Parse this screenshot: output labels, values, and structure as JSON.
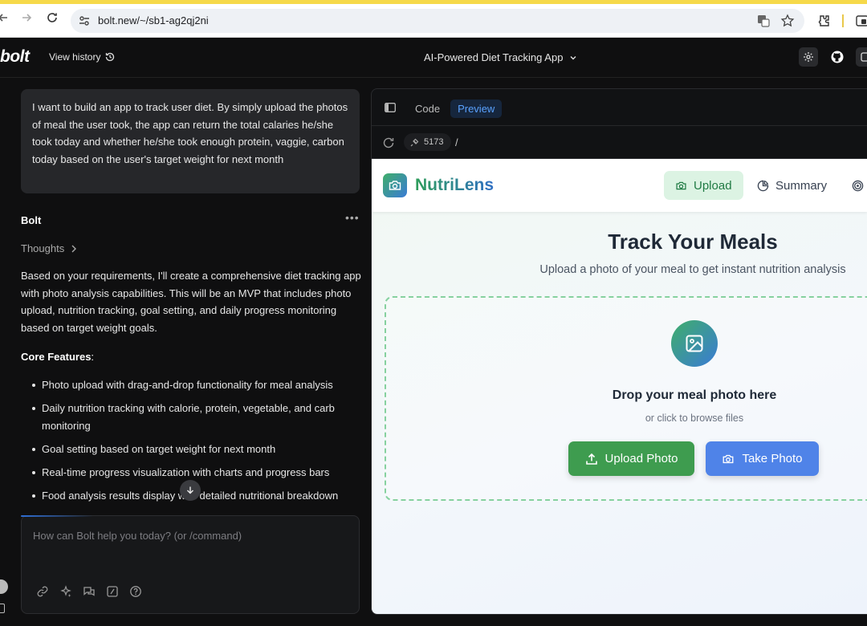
{
  "browser": {
    "url": "bolt.new/~/sb1-ag2qj2ni"
  },
  "header": {
    "logo": "bolt",
    "view_history": "View history",
    "project_title": "AI-Powered Diet Tracking App"
  },
  "chat": {
    "user_message": "I want to build an app to track user diet. By simply upload the photos of meal the user took, the app can return the total calaries he/she took today and whether he/she took enough protein, vaggie, carbon today based on the user's target weight for next month",
    "assistant_name": "Bolt",
    "thoughts_label": "Thoughts",
    "response_paragraph": "Based on your requirements, I'll create a comprehensive diet tracking app with photo analysis capabilities. This will be an MVP that includes photo upload, nutrition tracking, goal setting, and daily progress monitoring based on target weight goals.",
    "core_features_label": "Core Features",
    "features": [
      "Photo upload with drag-and-drop functionality for meal analysis",
      "Daily nutrition tracking with calorie, protein, vegetable, and carb monitoring",
      "Goal setting based on target weight for next month",
      "Real-time progress visualization with charts and progress bars",
      "Food analysis results display with detailed nutritional breakdown"
    ],
    "composer_placeholder": "How can Bolt help you today? (or /command)"
  },
  "workbench": {
    "tabs": [
      "Code",
      "Preview"
    ],
    "active_tab": "Preview",
    "port": "5173",
    "path": "/"
  },
  "preview": {
    "app_name": "NutriLens",
    "nav": [
      "Upload",
      "Summary"
    ],
    "title": "Track Your Meals",
    "subtitle": "Upload a photo of your meal to get instant nutrition analysis",
    "drop_title": "Drop your meal photo here",
    "drop_subtitle": "or click to browse files",
    "upload_button": "Upload Photo",
    "camera_button": "Take Photo"
  },
  "colors": {
    "accent_blue": "#5aa2ff",
    "green": "#3e9c4f",
    "blue": "#4f83e8"
  }
}
